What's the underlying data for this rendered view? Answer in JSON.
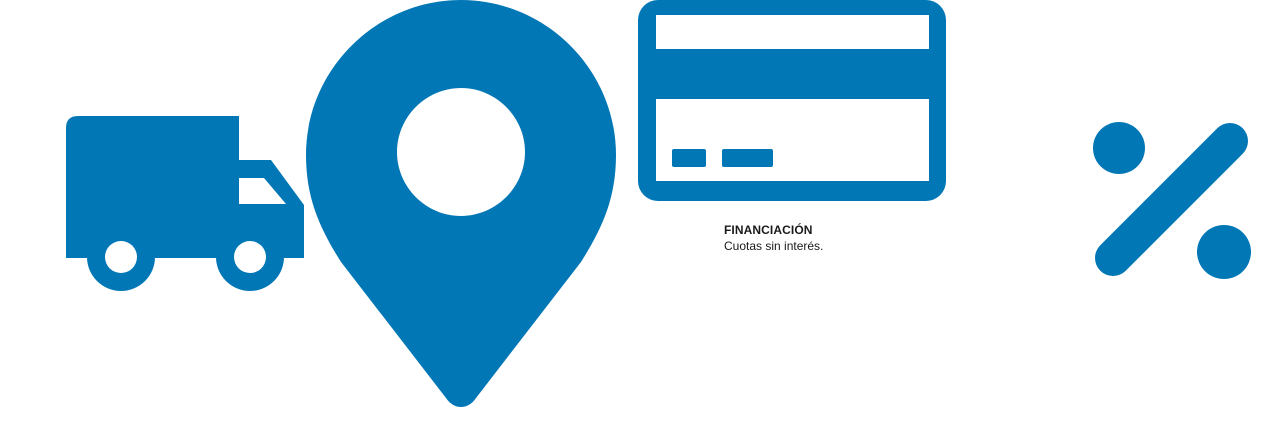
{
  "colors": {
    "brand": "#0277b6",
    "text": "#1a1a1a",
    "background": "#ffffff"
  },
  "features": [
    {
      "icon": "truck-icon"
    },
    {
      "icon": "location-pin-icon"
    },
    {
      "icon": "credit-card-icon",
      "title": "FINANCIACIÓN",
      "subtitle": "Cuotas sin interés."
    },
    {
      "icon": "percent-icon"
    }
  ]
}
